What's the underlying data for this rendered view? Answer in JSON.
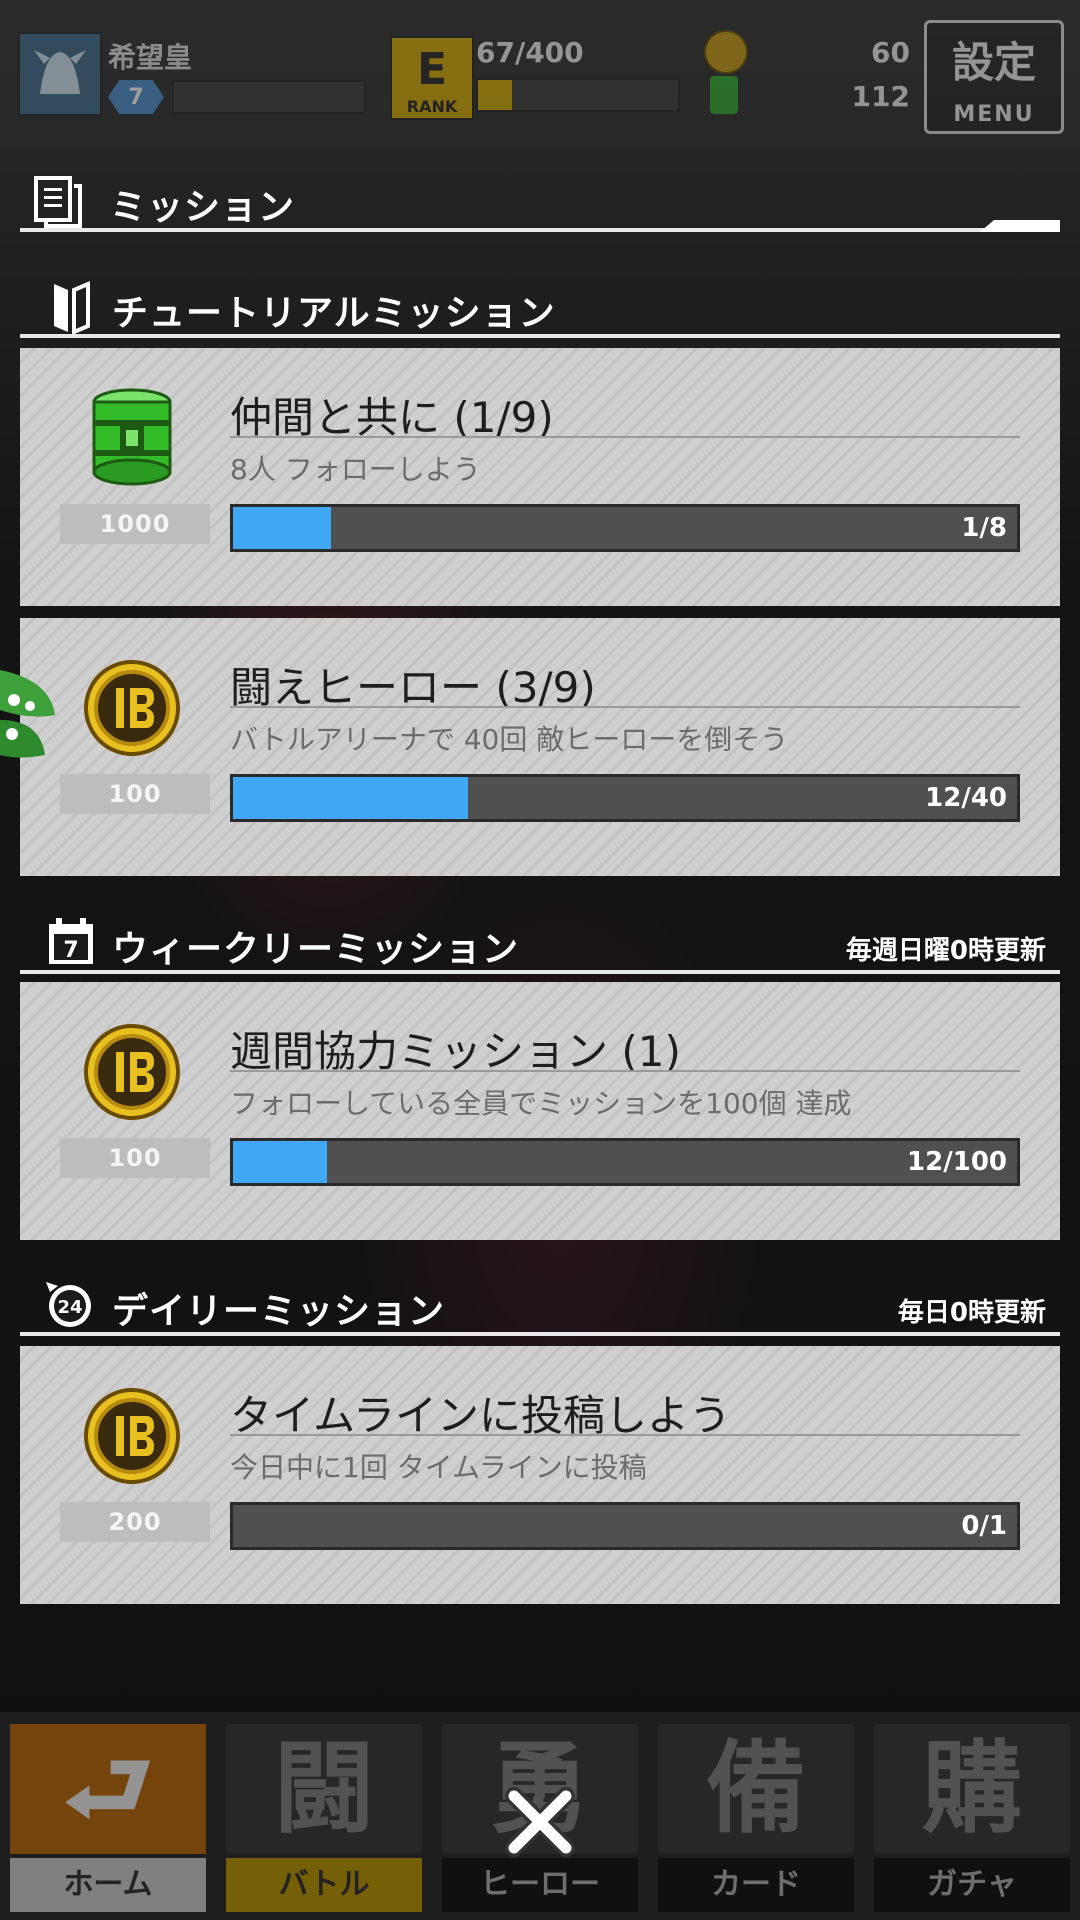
{
  "top_bar": {
    "player_name": "希望皇",
    "level": "7",
    "rank_label": "RANK",
    "rank_char": "E",
    "rank_progress": "67/400",
    "rank_progress_fraction": 0.17,
    "gold_value": "60",
    "green_value": "112",
    "menu_label": "設定",
    "menu_sub": "MENU"
  },
  "missions_header": {
    "title": "ミッション"
  },
  "tutorial": {
    "title": "チュートリアルミッション",
    "items": [
      {
        "title": "仲間と共に (1/9)",
        "desc": "8人 フォローしよう",
        "reward": "1000",
        "reward_icon": "green-can-icon",
        "progress_text": "1/8",
        "progress": 0.125
      },
      {
        "title": "闘えヒーロー (3/9)",
        "desc": "バトルアリーナで 40回 敵ヒーローを倒そう",
        "reward": "100",
        "reward_icon": "gold-coin-icon",
        "progress_text": "12/40",
        "progress": 0.3
      }
    ]
  },
  "weekly": {
    "title": "ウィークリーミッション",
    "refresh_note": "毎週日曜0時更新",
    "icon_day": "7",
    "items": [
      {
        "title": "週間協力ミッション (1)",
        "desc": "フォローしている全員でミッションを100個 達成",
        "reward": "100",
        "reward_icon": "gold-coin-icon",
        "progress_text": "12/100",
        "progress": 0.12
      }
    ]
  },
  "daily": {
    "title": "デイリーミッション",
    "refresh_note": "毎日0時更新",
    "icon_hours": "24",
    "items": [
      {
        "title": "タイムラインに投稿しよう",
        "desc": "今日中に1回 タイムラインに投稿",
        "reward": "200",
        "reward_icon": "gold-coin-icon",
        "progress_text": "0/1",
        "progress": 0.0
      }
    ]
  },
  "bottom_nav": [
    {
      "label": "ホーム",
      "art": "⮐",
      "state": "active"
    },
    {
      "label": "バトル",
      "art": "闘",
      "state": "battle"
    },
    {
      "label": "ヒーロー",
      "art": "勇",
      "state": ""
    },
    {
      "label": "カード",
      "art": "備",
      "state": ""
    },
    {
      "label": "ガチャ",
      "art": "購",
      "state": ""
    }
  ],
  "colors": {
    "progress_fill": "#3fa9f5",
    "card_bg": "#cfcfcf",
    "overlay": "#141414"
  }
}
